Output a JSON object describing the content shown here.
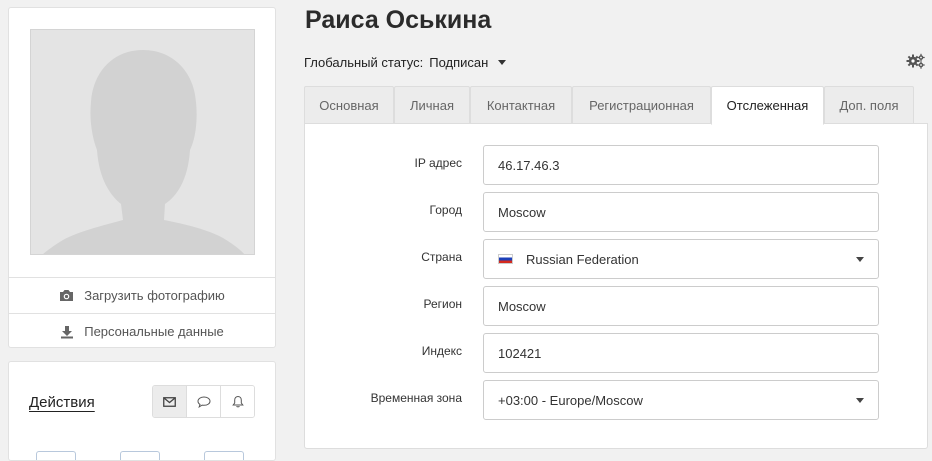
{
  "profile": {
    "upload_photo": "Загрузить фотографию",
    "personal_data": "Персональные данные"
  },
  "actions": {
    "title": "Действия",
    "buttons": [
      "mail-icon",
      "chat-bubble-icon",
      "bell-icon"
    ]
  },
  "header": {
    "name": "Раиса Оськина",
    "status_label": "Глобальный статус:",
    "status_value": "Подписан"
  },
  "tabs": [
    {
      "label": "Основная"
    },
    {
      "label": "Личная"
    },
    {
      "label": "Контактная"
    },
    {
      "label": "Регистрационная"
    },
    {
      "label": "Отслеженная",
      "active": true
    },
    {
      "label": "Доп. поля"
    }
  ],
  "form": {
    "ip": {
      "label": "IP адрес",
      "value": "46.17.46.3"
    },
    "city": {
      "label": "Город",
      "value": "Moscow"
    },
    "country": {
      "label": "Страна",
      "value": "Russian Federation",
      "flag": "russia-flag"
    },
    "region": {
      "label": "Регион",
      "value": "Moscow"
    },
    "postal": {
      "label": "Индекс",
      "value": "102421"
    },
    "timezone": {
      "label": "Временная зона",
      "value": "+03:00 - Europe/Moscow"
    }
  },
  "colors": {
    "background": "#f1f1f1",
    "panel": "#ffffff",
    "active_tab": "#ffffff",
    "inactive_tab": "#ececec"
  }
}
